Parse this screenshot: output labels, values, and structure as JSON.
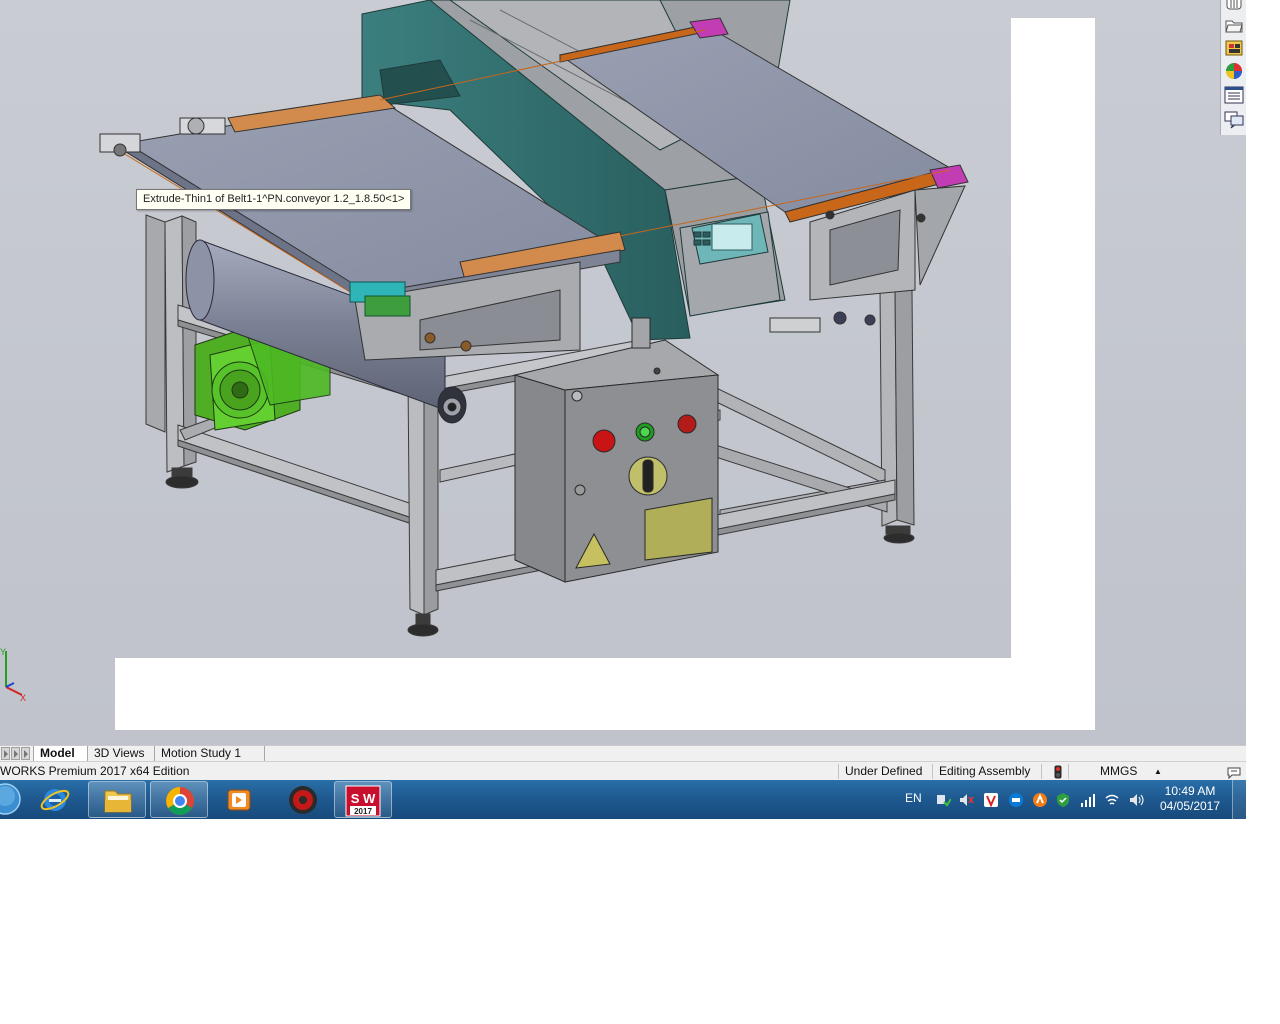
{
  "viewport": {
    "tooltip": "Extrude-Thin1 of Belt1-1^PN.conveyor 1.2_1.8.50<1>",
    "triad_axes": [
      "Y",
      "X"
    ]
  },
  "task_pane": {
    "buttons": [
      "solidworks-resources-icon",
      "design-library-icon",
      "file-explorer-icon",
      "view-palette-icon",
      "appearances-icon",
      "custom-properties-icon",
      "forum-icon"
    ]
  },
  "tabs": [
    {
      "label": "Model",
      "active": true
    },
    {
      "label": "3D Views",
      "active": false
    },
    {
      "label": "Motion Study 1",
      "active": false
    }
  ],
  "status_bar": {
    "product": "WORKS Premium 2017 x64 Edition",
    "state": "Under Defined",
    "mode": "Editing Assembly",
    "units": "MMGS",
    "units_arrow": "▲"
  },
  "taskbar": {
    "apps": [
      "start-orb-icon",
      "internet-explorer-icon",
      "file-explorer-icon",
      "chrome-icon",
      "media-player-icon",
      "antivirus-icon",
      "solidworks-2017-icon"
    ],
    "solidworks_badge": "S W",
    "solidworks_year": "2017",
    "language": "EN",
    "time": "10:49 AM",
    "date": "04/05/2017"
  },
  "colors": {
    "viewport_bg": "#c3c6ce",
    "frame_steel": "#b6b8bb",
    "belt": "#8f96a9",
    "belt_edge": "#c8661a",
    "detector_teal": "#2f6c6c",
    "motor_green": "#58c22a",
    "panel_plate": "#b1ae5a",
    "taskbar": "#1f5a91"
  }
}
